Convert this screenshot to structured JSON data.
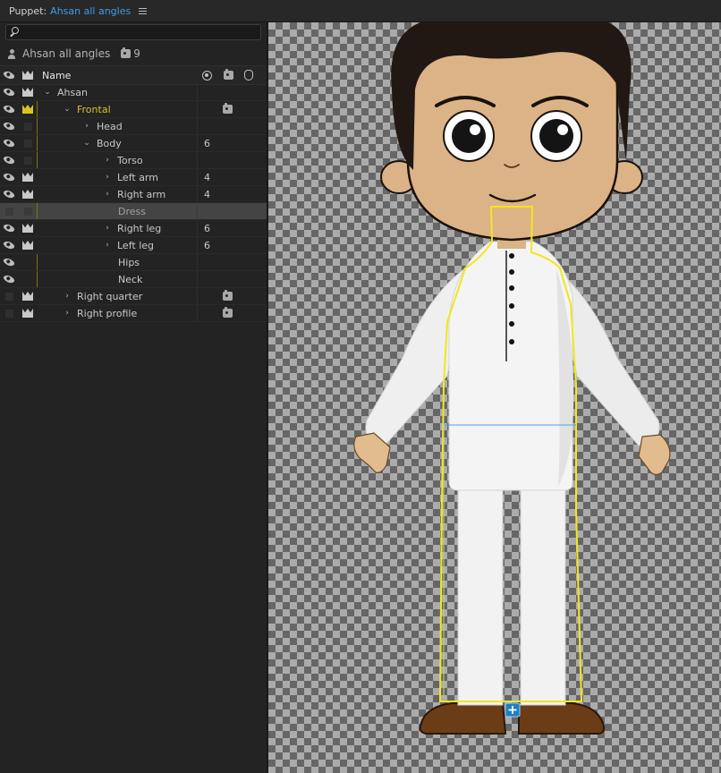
{
  "titlebar": {
    "prefix": "Puppet:",
    "name": "Ahsan all angles"
  },
  "puppet": {
    "name": "Ahsan all angles",
    "count": "9"
  },
  "header": {
    "name": "Name"
  },
  "rows": [
    {
      "label": "Ahsan",
      "value": ""
    },
    {
      "label": "Frontal",
      "value": ""
    },
    {
      "label": "Head",
      "value": ""
    },
    {
      "label": "Body",
      "value": "6"
    },
    {
      "label": "Torso",
      "value": ""
    },
    {
      "label": "Left arm",
      "value": "4"
    },
    {
      "label": "Right arm",
      "value": "4"
    },
    {
      "label": "Dress",
      "value": ""
    },
    {
      "label": "Right leg",
      "value": "6"
    },
    {
      "label": "Left leg",
      "value": "6"
    },
    {
      "label": "Hips",
      "value": ""
    },
    {
      "label": "Neck",
      "value": ""
    },
    {
      "label": "Right quarter",
      "value": ""
    },
    {
      "label": "Right profile",
      "value": ""
    }
  ],
  "colors": {
    "accent": "#3e9bf0",
    "gold": "#d7c22b",
    "selection": "#444444"
  }
}
